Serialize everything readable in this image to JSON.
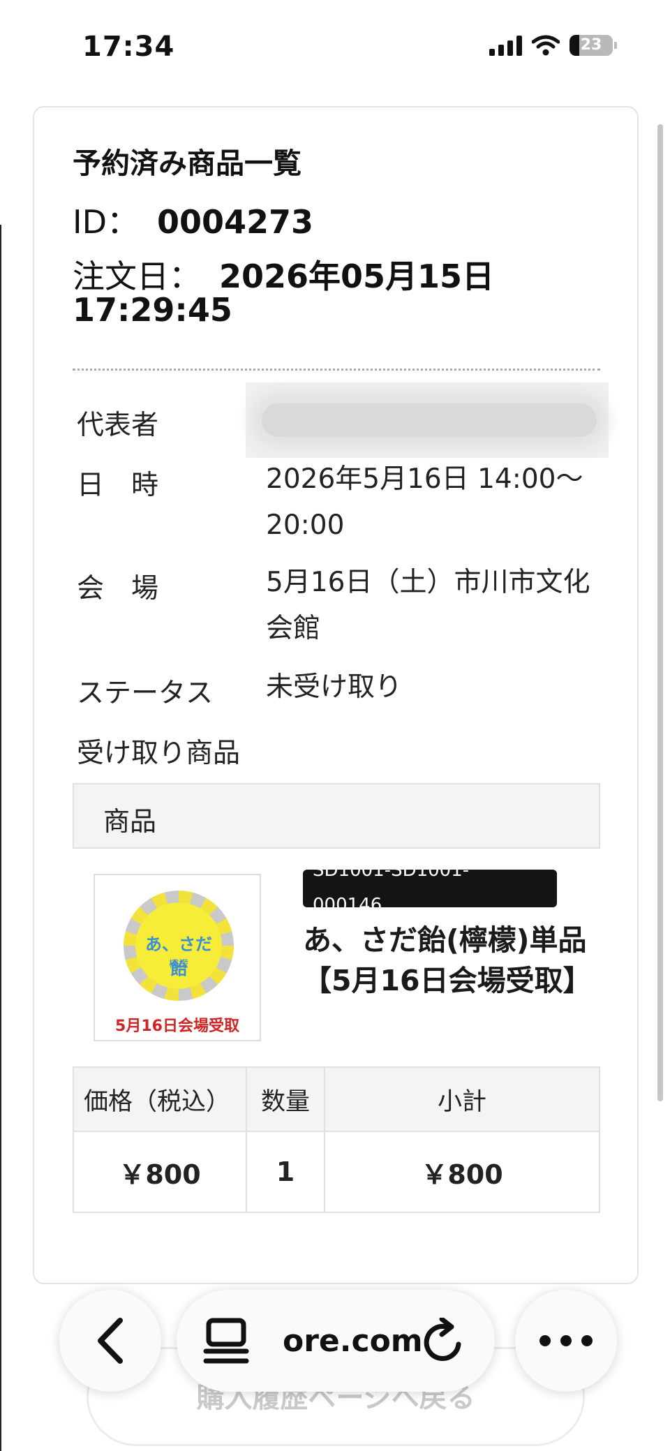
{
  "status_bar": {
    "time": "17:34",
    "battery": "23",
    "battery_fraction": 0.23
  },
  "page": {
    "title": "予約済み商品一覧",
    "id_label": "ID：",
    "id_value": "0004273",
    "date_label": "注文日：",
    "date_value": "2026年05月15日 17:29:45"
  },
  "details": {
    "representative_label": "代表者",
    "datetime_label": "日　時",
    "datetime_value": "2026年5月16日 14:00〜20:00",
    "venue_label": "会　場",
    "venue_value": "5月16日（土）市川市文化会館",
    "status_label": "ステータス",
    "status_value": "未受け取り",
    "pickup_label": "受け取り商品"
  },
  "product": {
    "header": "商品",
    "code_line1": "SD1001-SD1001-",
    "code_line2": "000146",
    "name": "あ、さだ飴(檸檬)単品【5月16日会場受取】",
    "thumb_title": "あ、さだ飴",
    "thumb_subtitle": "檸檬",
    "thumb_caption": "5月16日会場受取"
  },
  "price_table": {
    "headers": [
      "価格（税込）",
      "数量",
      "小計"
    ],
    "row": [
      "￥800",
      "1",
      "￥800"
    ]
  },
  "footer": {
    "back_button": "購入履歴ページへ戻る"
  },
  "toolbar": {
    "url": "ore.com"
  },
  "colors": {
    "accent_red": "#d22424",
    "badge_yellow": "#f7ec38",
    "badge_blue": "#3a8fd6"
  }
}
